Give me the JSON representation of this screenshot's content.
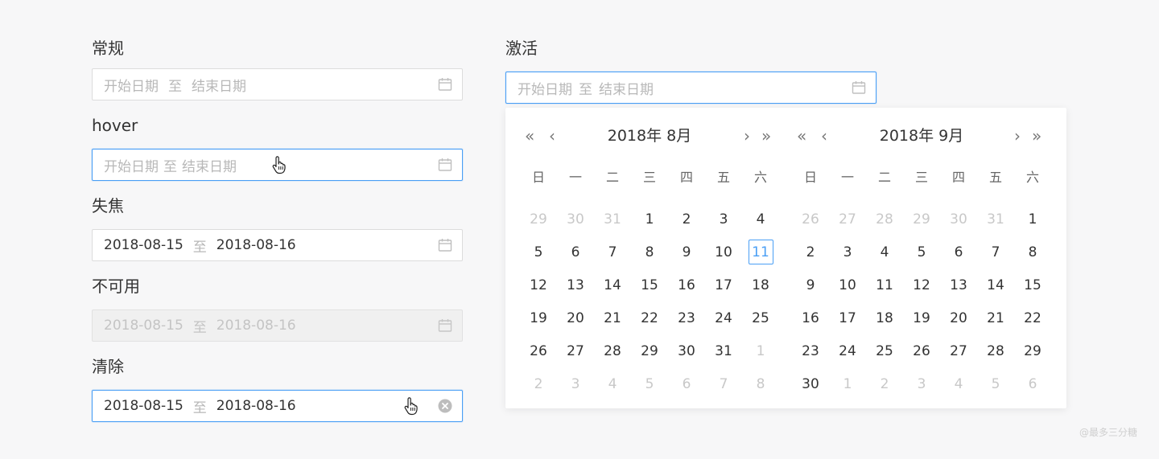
{
  "colors": {
    "accent": "#4a9ff5",
    "placeholder": "#b8b8b8",
    "muted": "#c8c8c8"
  },
  "sections": {
    "normal": {
      "label": "常规",
      "start_placeholder": "开始日期",
      "separator": "至",
      "end_placeholder": "结束日期",
      "icon": "calendar-icon"
    },
    "hover": {
      "label": "hover",
      "start_placeholder": "开始日期",
      "separator": "至",
      "end_placeholder": "结束日期",
      "icon": "calendar-icon"
    },
    "blur": {
      "label": "失焦",
      "start_value": "2018-08-15",
      "separator": "至",
      "end_value": "2018-08-16",
      "icon": "calendar-icon"
    },
    "disabled": {
      "label": "不可用",
      "start_value": "2018-08-15",
      "separator": "至",
      "end_value": "2018-08-16",
      "icon": "calendar-icon"
    },
    "clear": {
      "label": "清除",
      "start_value": "2018-08-15",
      "separator": "至",
      "end_value": "2018-08-16",
      "icon": "clear-icon"
    },
    "active": {
      "label": "激活",
      "start_placeholder": "开始日期",
      "separator": "至",
      "end_placeholder": "结束日期",
      "icon": "calendar-icon"
    }
  },
  "calendar": {
    "prev_year": "«",
    "prev_month": "‹",
    "next_month": "›",
    "next_year": "»",
    "weekdays": [
      "日",
      "一",
      "二",
      "三",
      "四",
      "五",
      "六"
    ],
    "left": {
      "title": "2018年 8月",
      "days": [
        "29",
        "30",
        "31",
        "1",
        "2",
        "3",
        "4",
        "5",
        "6",
        "7",
        "8",
        "9",
        "10",
        "11",
        "12",
        "13",
        "14",
        "15",
        "16",
        "17",
        "18",
        "19",
        "20",
        "21",
        "22",
        "23",
        "24",
        "25",
        "26",
        "27",
        "28",
        "29",
        "30",
        "31",
        "1",
        "2",
        "3",
        "4",
        "5",
        "6",
        "7",
        "8"
      ],
      "muted_indexes": [
        0,
        1,
        2,
        34,
        35,
        36,
        37,
        38,
        39,
        40,
        41
      ],
      "today_index": 13
    },
    "right": {
      "title": "2018年 9月",
      "days": [
        "26",
        "27",
        "28",
        "29",
        "30",
        "31",
        "1",
        "2",
        "3",
        "4",
        "5",
        "6",
        "7",
        "8",
        "9",
        "10",
        "11",
        "12",
        "13",
        "14",
        "15",
        "16",
        "17",
        "18",
        "19",
        "20",
        "21",
        "22",
        "23",
        "24",
        "25",
        "26",
        "27",
        "28",
        "29",
        "30",
        "1",
        "2",
        "3",
        "4",
        "5",
        "6"
      ],
      "muted_indexes": [
        0,
        1,
        2,
        3,
        4,
        5,
        36,
        37,
        38,
        39,
        40,
        41
      ],
      "today_index": -1
    }
  },
  "watermark": "@最多三分糖"
}
